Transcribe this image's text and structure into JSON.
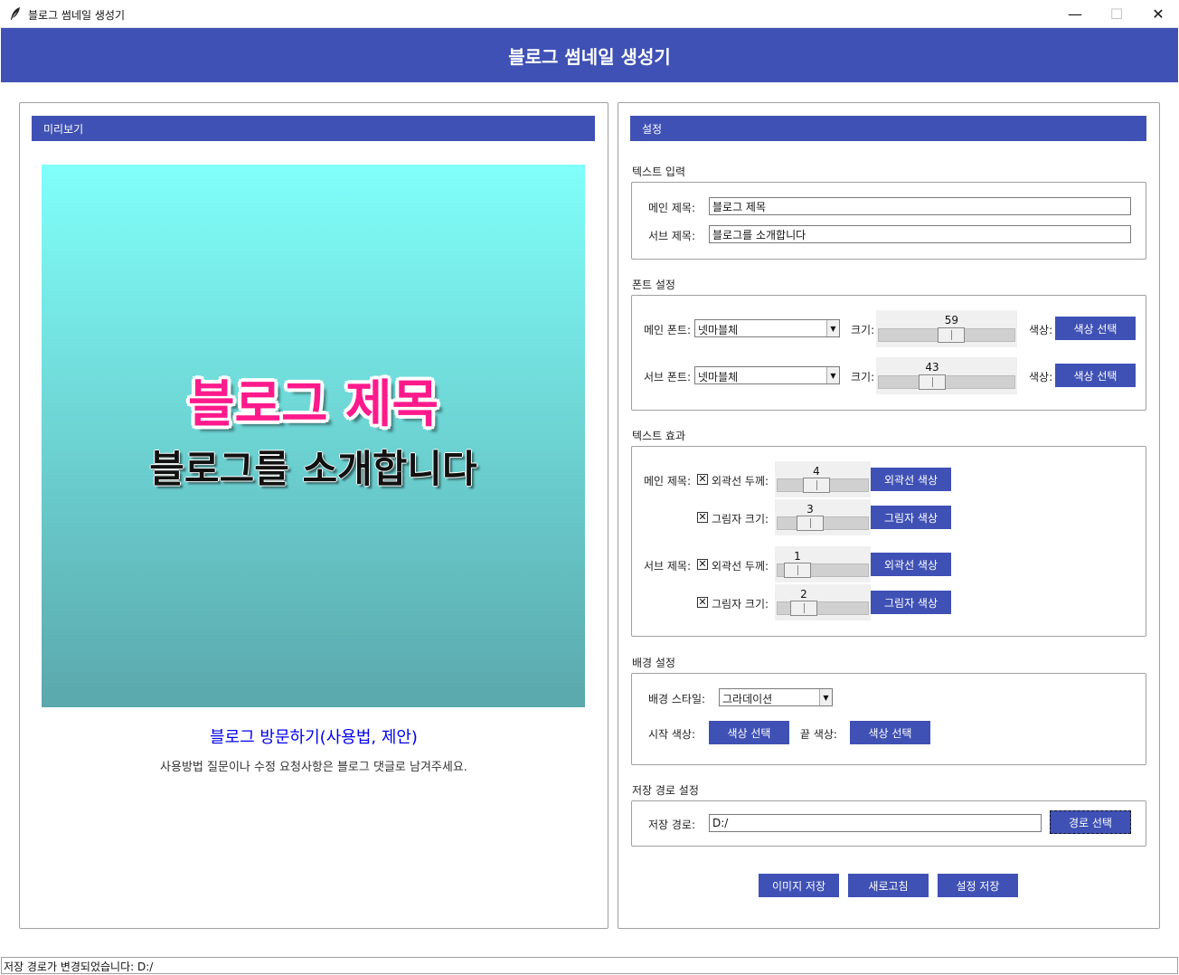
{
  "window": {
    "title": "블로그 썸네일 생성기",
    "controls": {
      "minimize": "—",
      "maximize": "☐",
      "close": "✕"
    }
  },
  "header": {
    "title": "블로그 썸네일 생성기"
  },
  "colors": {
    "accent": "#3f51b5",
    "main_text": "#ff1a8c",
    "gradient_start": "#80fffa",
    "gradient_end": "#5aa8ac",
    "link": "#0000ee"
  },
  "preview": {
    "panel_title": "미리보기",
    "main_title": "블로그 제목",
    "sub_title": "블로그를 소개합니다",
    "visit_link": "블로그 방문하기(사용법, 제안)",
    "hint": "사용방법 질문이나 수정 요청사항은 블로그 댓글로 남겨주세요."
  },
  "settings": {
    "panel_title": "설정",
    "text_input": {
      "section": "텍스트 입력",
      "main_label": "메인 제목:",
      "main_value": "블로그 제목",
      "sub_label": "서브 제목:",
      "sub_value": "블로그를 소개합니다"
    },
    "font": {
      "section": "폰트 설정",
      "main_font_label": "메인 폰트:",
      "main_font_value": "넷마블체",
      "sub_font_label": "서브 폰트:",
      "sub_font_value": "넷마블체",
      "size_label": "크기:",
      "main_size": 59,
      "sub_size": 43,
      "size_min": 10,
      "size_max": 100,
      "color_label": "색상:",
      "color_button": "색상 선택"
    },
    "effects": {
      "section": "텍스트 효과",
      "main_label": "메인 제목:",
      "sub_label": "서브 제목:",
      "outline_label": "외곽선 두께:",
      "shadow_label": "그림자 크기:",
      "checked_mark": "✕",
      "main_outline": 4,
      "main_shadow": 3,
      "sub_outline": 1,
      "sub_shadow": 2,
      "effect_min": 0,
      "effect_max": 10,
      "outline_color_button": "외곽선 색상",
      "shadow_color_button": "그림자 색상"
    },
    "background": {
      "section": "배경 설정",
      "style_label": "배경 스타일:",
      "style_value": "그라데이션",
      "start_label": "시작 색상:",
      "end_label": "끝 색상:",
      "color_button": "색상 선택"
    },
    "save_path": {
      "section": "저장 경로 설정",
      "label": "저장 경로:",
      "value": "D:/",
      "button": "경로 선택"
    },
    "actions": {
      "save_image": "이미지 저장",
      "refresh": "새로고침",
      "save_settings": "설정 저장"
    }
  },
  "status": {
    "text": "저장 경로가 변경되었습니다: D:/"
  }
}
